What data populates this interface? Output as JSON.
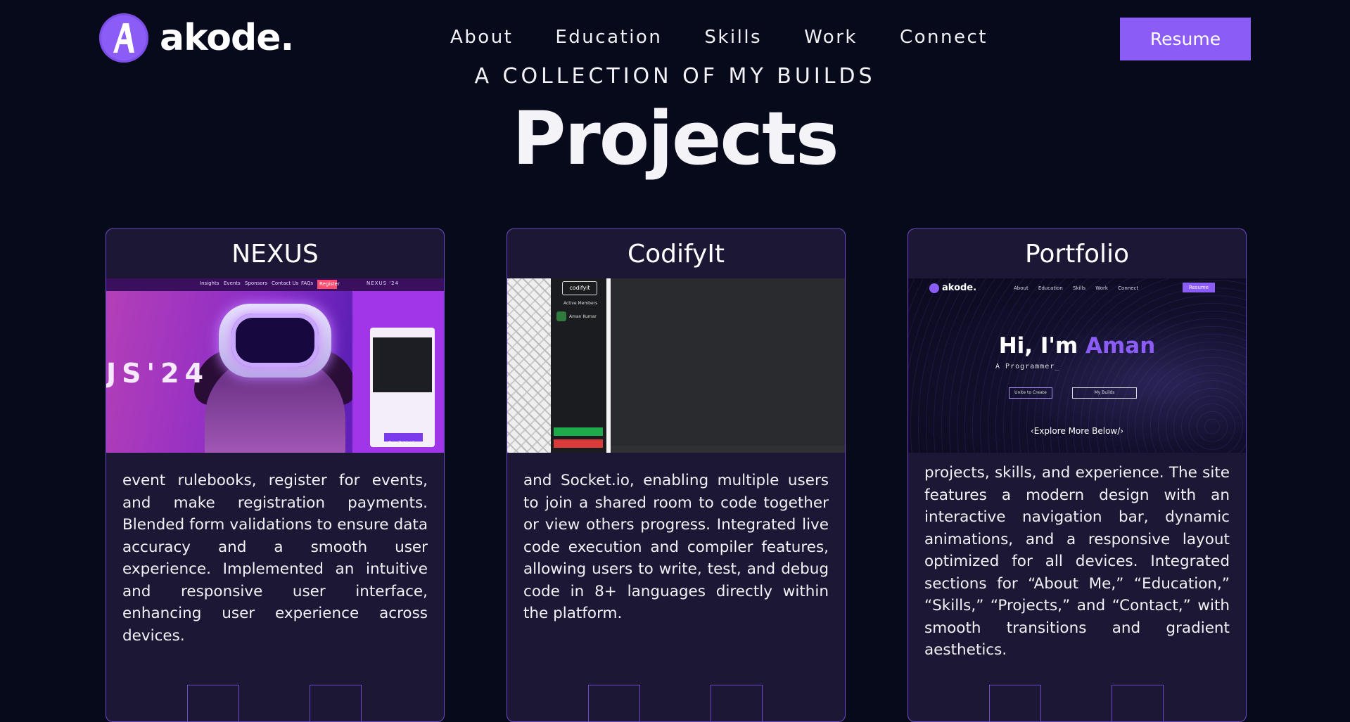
{
  "nav": {
    "logo_text": "akode.",
    "links": [
      "About",
      "Education",
      "Skills",
      "Work",
      "Connect"
    ],
    "resume_label": "Resume"
  },
  "section": {
    "subtitle": "A COLLECTION OF MY BUILDS",
    "title": "Projects"
  },
  "projects": [
    {
      "title": "NEXUS",
      "description": "event rulebooks, register for events, and make registration payments. Blended form validations to ensure data accuracy and a smooth user experience. Implemented an intuitive and responsive user interface, enhancing user experience across devices.",
      "screenshot": {
        "nav_items": [
          "Insights",
          "Events",
          "Sponsors",
          "Contact Us",
          "FAQs",
          "Register"
        ],
        "tag": "NEXUS '24",
        "hero_text": "JS'24",
        "button": "Open Rulebook"
      }
    },
    {
      "title": "CodifyIt",
      "description": "and Socket.io, enabling multiple users to join a shared room to code together or view others progress. Integrated live code execution and compiler features, allowing users to write, test, and debug code in 8+ languages directly within the platform.",
      "screenshot": {
        "logo": "codifyit",
        "members_label": "Active Members",
        "member_name": "Aman Kumar"
      }
    },
    {
      "title": "Portfolio",
      "description": "projects, skills, and experience. The site features a modern design with an interactive navigation bar, dynamic animations, and a responsive layout optimized for all devices. Integrated sections for “About Me,” “Education,” “Skills,” “Projects,” and “Contact,” with smooth transitions and gradient aesthetics.",
      "screenshot": {
        "logo": "akode.",
        "nav": "About Education Skills Work Connect",
        "resume": "Resume",
        "greeting": "Hi, I'm",
        "name": "Aman",
        "role": "A Programmer_",
        "button1": "Unite to Create",
        "button2": "My Builds",
        "explore": "‹Explore More Below/›"
      }
    }
  ],
  "colors": {
    "background": "#070a1b",
    "accent": "#8b5cf6",
    "card": "#1c1734",
    "card_border": "#6d4bc4"
  }
}
